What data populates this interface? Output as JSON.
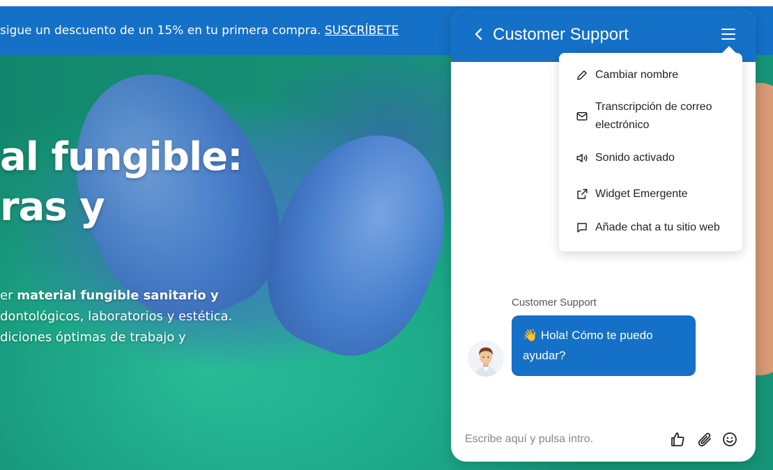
{
  "promo": {
    "text": "sigue un descuento de un 15% en tu primera compra. ",
    "link": "SUSCRÍBETE"
  },
  "hero": {
    "headline_line1": "al fungible:",
    "headline_line2": "ras y",
    "desc_line1_pre": "er ",
    "desc_line1_bold": "material fungible sanitario y",
    "desc_line2": "dontológicos, laboratorios y estética.",
    "desc_line3": "diciones óptimas de trabajo y"
  },
  "chat": {
    "title": "Customer Support",
    "menu_items": [
      {
        "icon": "pencil-icon",
        "label": "Cambiar nombre"
      },
      {
        "icon": "mail-icon",
        "label": "Transcripción de correo electrónico"
      },
      {
        "icon": "speaker-icon",
        "label": "Sonido activado"
      },
      {
        "icon": "external-link-icon",
        "label": "Widget Emergente"
      },
      {
        "icon": "chat-bubble-icon",
        "label": "Añade chat a tu sitio web"
      }
    ],
    "sender_name": "Customer Support",
    "message": "👋 Hola! Cómo te puedo ayudar?",
    "input_placeholder": "Escribe aquí y pulsa intro.",
    "composer_icons": [
      "thumbs-up-icon",
      "paperclip-icon",
      "smiley-icon"
    ]
  },
  "colors": {
    "brand_blue": "#1570c7",
    "white": "#ffffff"
  }
}
